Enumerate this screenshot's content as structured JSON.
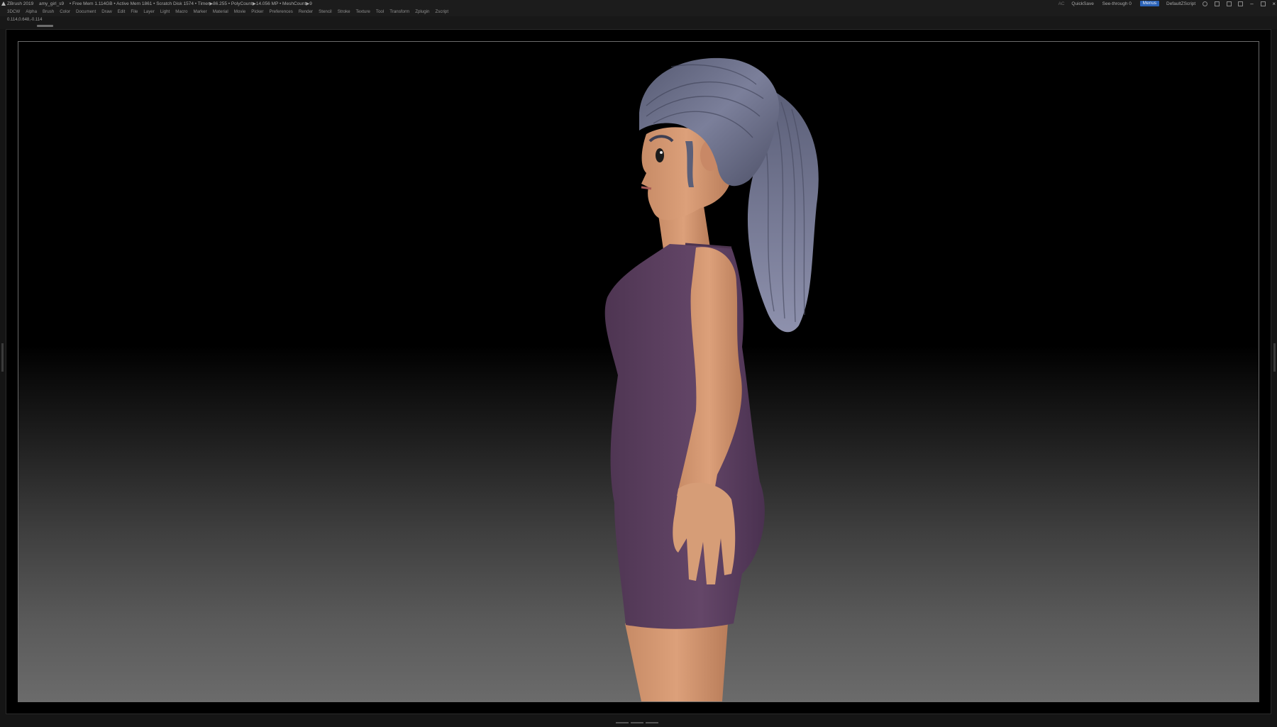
{
  "titlebar": {
    "app": "ZBrush 2019",
    "document": "amy_girl_s9",
    "stats": "• Free Mem 1.114GB • Active Mem 1861 • Scratch Disk 1574 •  Timer▶86.255 • PolyCount▶14.056 MP  • MeshCount▶9",
    "ac": "AC",
    "quicksave": "QuickSave",
    "see_through": "See-through  0",
    "menus": "Menus",
    "default_zscript": "DefaultZScript"
  },
  "menubar": {
    "items": [
      "3DCW",
      "Alpha",
      "Brush",
      "Color",
      "Document",
      "Draw",
      "Edit",
      "File",
      "Layer",
      "Light",
      "Macro",
      "Marker",
      "Material",
      "Movie",
      "Picker",
      "Preferences",
      "Render",
      "Stencil",
      "Stroke",
      "Texture",
      "Tool",
      "Transform",
      "Zplugin",
      "Zscript"
    ]
  },
  "coords": "0.114,0.648,-0.114",
  "colors": {
    "skin": "#d49a73",
    "dress": "#5a3f5d",
    "hair": "#666a85",
    "hair_tie": "#3d7a52",
    "accent": "#2b63b8"
  }
}
